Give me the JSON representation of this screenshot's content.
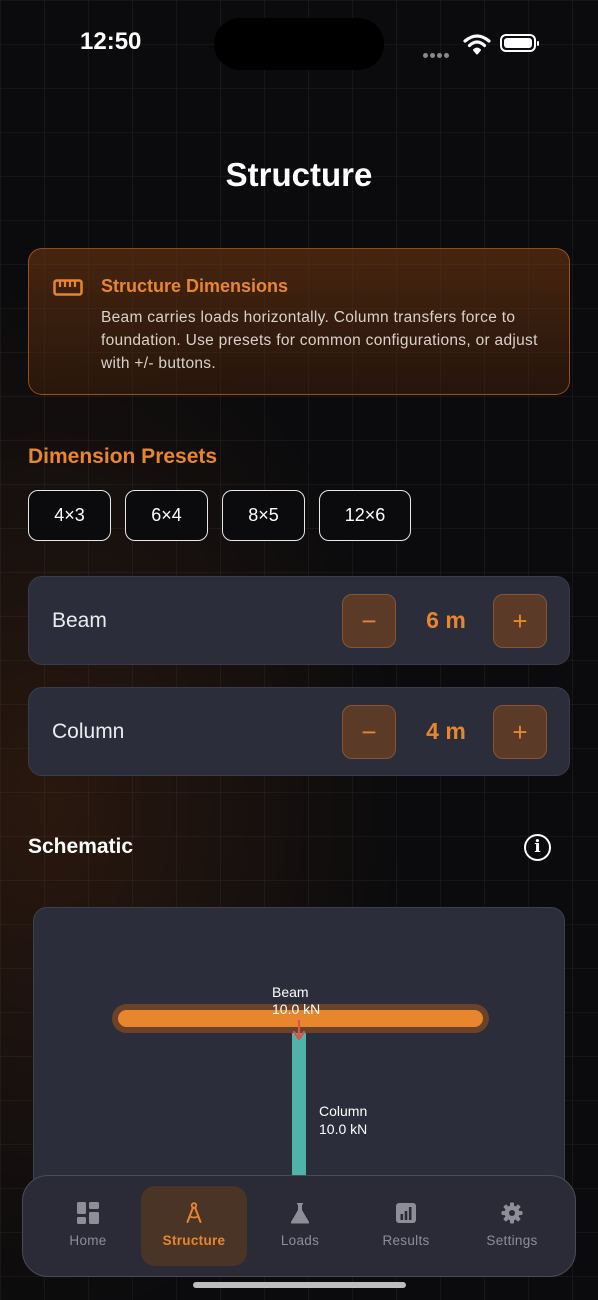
{
  "status": {
    "time": "12:50"
  },
  "page": {
    "title": "Structure"
  },
  "info_card": {
    "icon": "ruler-icon",
    "title": "Structure Dimensions",
    "body": "Beam carries loads horizontally. Column transfers force to foundation. Use presets for common configurations, or adjust with +/- buttons."
  },
  "presets": {
    "title": "Dimension Presets",
    "items": [
      "4×3",
      "6×4",
      "8×5",
      "12×6"
    ]
  },
  "dimensions": {
    "beam": {
      "label": "Beam",
      "value": "6 m",
      "minus": "−",
      "plus": "+"
    },
    "column": {
      "label": "Column",
      "value": "4 m",
      "minus": "−",
      "plus": "+"
    }
  },
  "schematic": {
    "title": "Schematic",
    "info_icon": "i",
    "beam_label": "Beam",
    "beam_load": "10.0 kN",
    "column_label": "Column",
    "column_load": "10.0 kN",
    "colors": {
      "beam": "#e8862e",
      "column": "#4fb3a9",
      "load_arrow": "#d9534f"
    }
  },
  "tabs": [
    {
      "label": "Home",
      "icon": "grid-icon"
    },
    {
      "label": "Structure",
      "icon": "compass-icon"
    },
    {
      "label": "Loads",
      "icon": "flask-icon"
    },
    {
      "label": "Results",
      "icon": "chart-icon"
    },
    {
      "label": "Settings",
      "icon": "gear-icon"
    }
  ],
  "colors": {
    "accent": "#e8862e",
    "card": "#2c2d3a"
  }
}
